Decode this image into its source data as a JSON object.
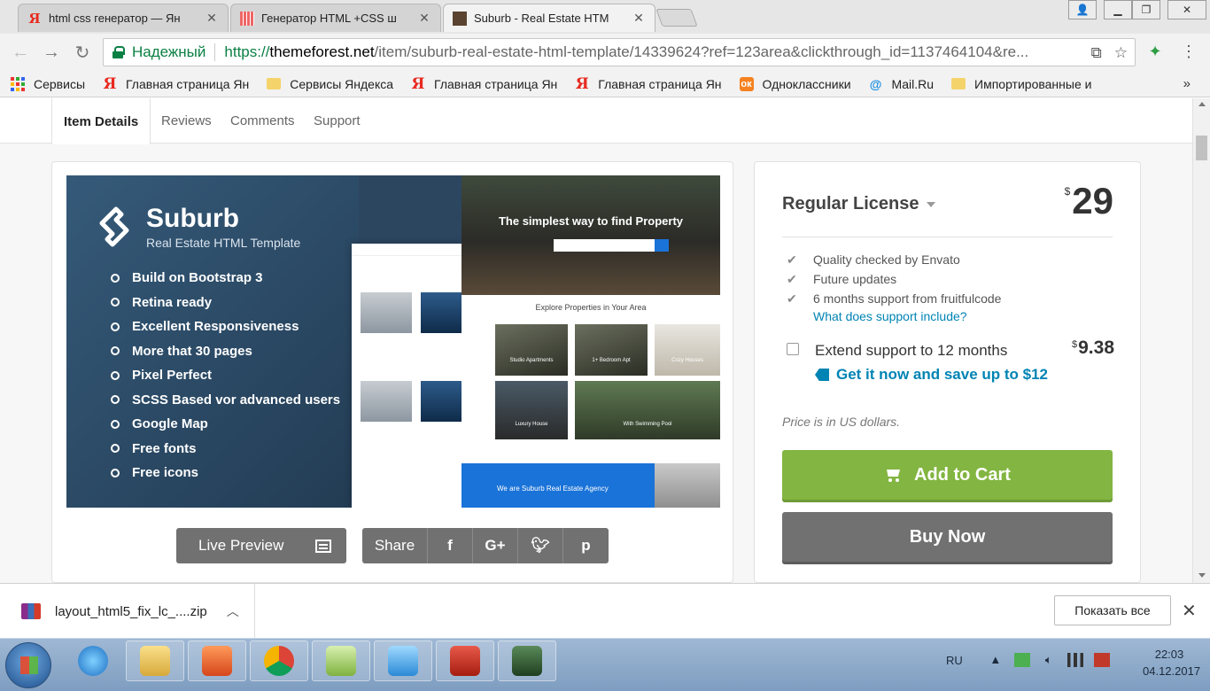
{
  "browser": {
    "tabs": [
      {
        "title": "html css генератор — Ян",
        "favicon": "yandex-icon"
      },
      {
        "title": "Генератор HTML +CSS ш",
        "favicon": "grid-icon"
      },
      {
        "title": "Suburb - Real Estate HTM",
        "favicon": "suburb-thumb-icon"
      }
    ],
    "secure_label": "Надежный",
    "url_scheme": "https://",
    "url_host": "themeforest.net",
    "url_path": "/item/suburb-real-estate-html-template/14339624?ref=123area&clickthrough_id=1137464104&re...",
    "bookmarks": [
      {
        "label": "Сервисы",
        "icon": "apps-icon"
      },
      {
        "label": "Главная страница Ян",
        "icon": "yandex-icon"
      },
      {
        "label": "Сервисы Яндекса",
        "icon": "folder-icon"
      },
      {
        "label": "Главная страница Ян",
        "icon": "yandex-icon"
      },
      {
        "label": "Главная страница Ян",
        "icon": "yandex-icon"
      },
      {
        "label": "Одноклассники",
        "icon": "ok-icon"
      },
      {
        "label": "Mail.Ru",
        "icon": "mailru-icon"
      },
      {
        "label": "Импортированные и",
        "icon": "folder-icon"
      }
    ],
    "more_bookmarks": "»"
  },
  "page": {
    "tabs": [
      "Item Details",
      "Reviews",
      "Comments",
      "Support"
    ],
    "preview": {
      "brand": "Suburb",
      "subtitle": "Real Estate HTML Template",
      "features": [
        "Build on Bootstrap 3",
        "Retina ready",
        "Excellent Responsiveness",
        "More that 30 pages",
        "Pixel Perfect",
        "SCSS Based vor advanced users",
        "Google Map",
        "Free fonts",
        "Free icons"
      ],
      "hero_title": "The simplest way to find Property",
      "explore_title": "Explore Properties in Your Area",
      "tiles": [
        "Studio Apartments",
        "1+ Bedroom Apt",
        "Cozy Houses",
        "Luxury House",
        "With Swimming Pool"
      ],
      "agency": "We are Suburb Real Estate Agency"
    },
    "live_preview_label": "Live Preview",
    "share_label": "Share",
    "social": [
      "f",
      "G+",
      "t",
      "p"
    ]
  },
  "purchase": {
    "license": "Regular License",
    "currency": "$",
    "price": "29",
    "checks": [
      "Quality checked by Envato",
      "Future updates",
      "6 months support from fruitfulcode"
    ],
    "support_link": "What does support include?",
    "extend_label": "Extend support to 12 months",
    "extend_price": "9.38",
    "save_label": "Get it now and save up to $12",
    "note": "Price is in US dollars.",
    "add_to_cart": "Add to Cart",
    "buy_now": "Buy Now",
    "colors": {
      "cart": "#82b541",
      "buy": "#717171",
      "link": "#0084b4"
    }
  },
  "downloads": {
    "file": "layout_html5_fix_lc_....zip",
    "show_all": "Показать все"
  },
  "taskbar": {
    "lang": "RU",
    "time": "22:03",
    "date": "04.12.2017"
  }
}
